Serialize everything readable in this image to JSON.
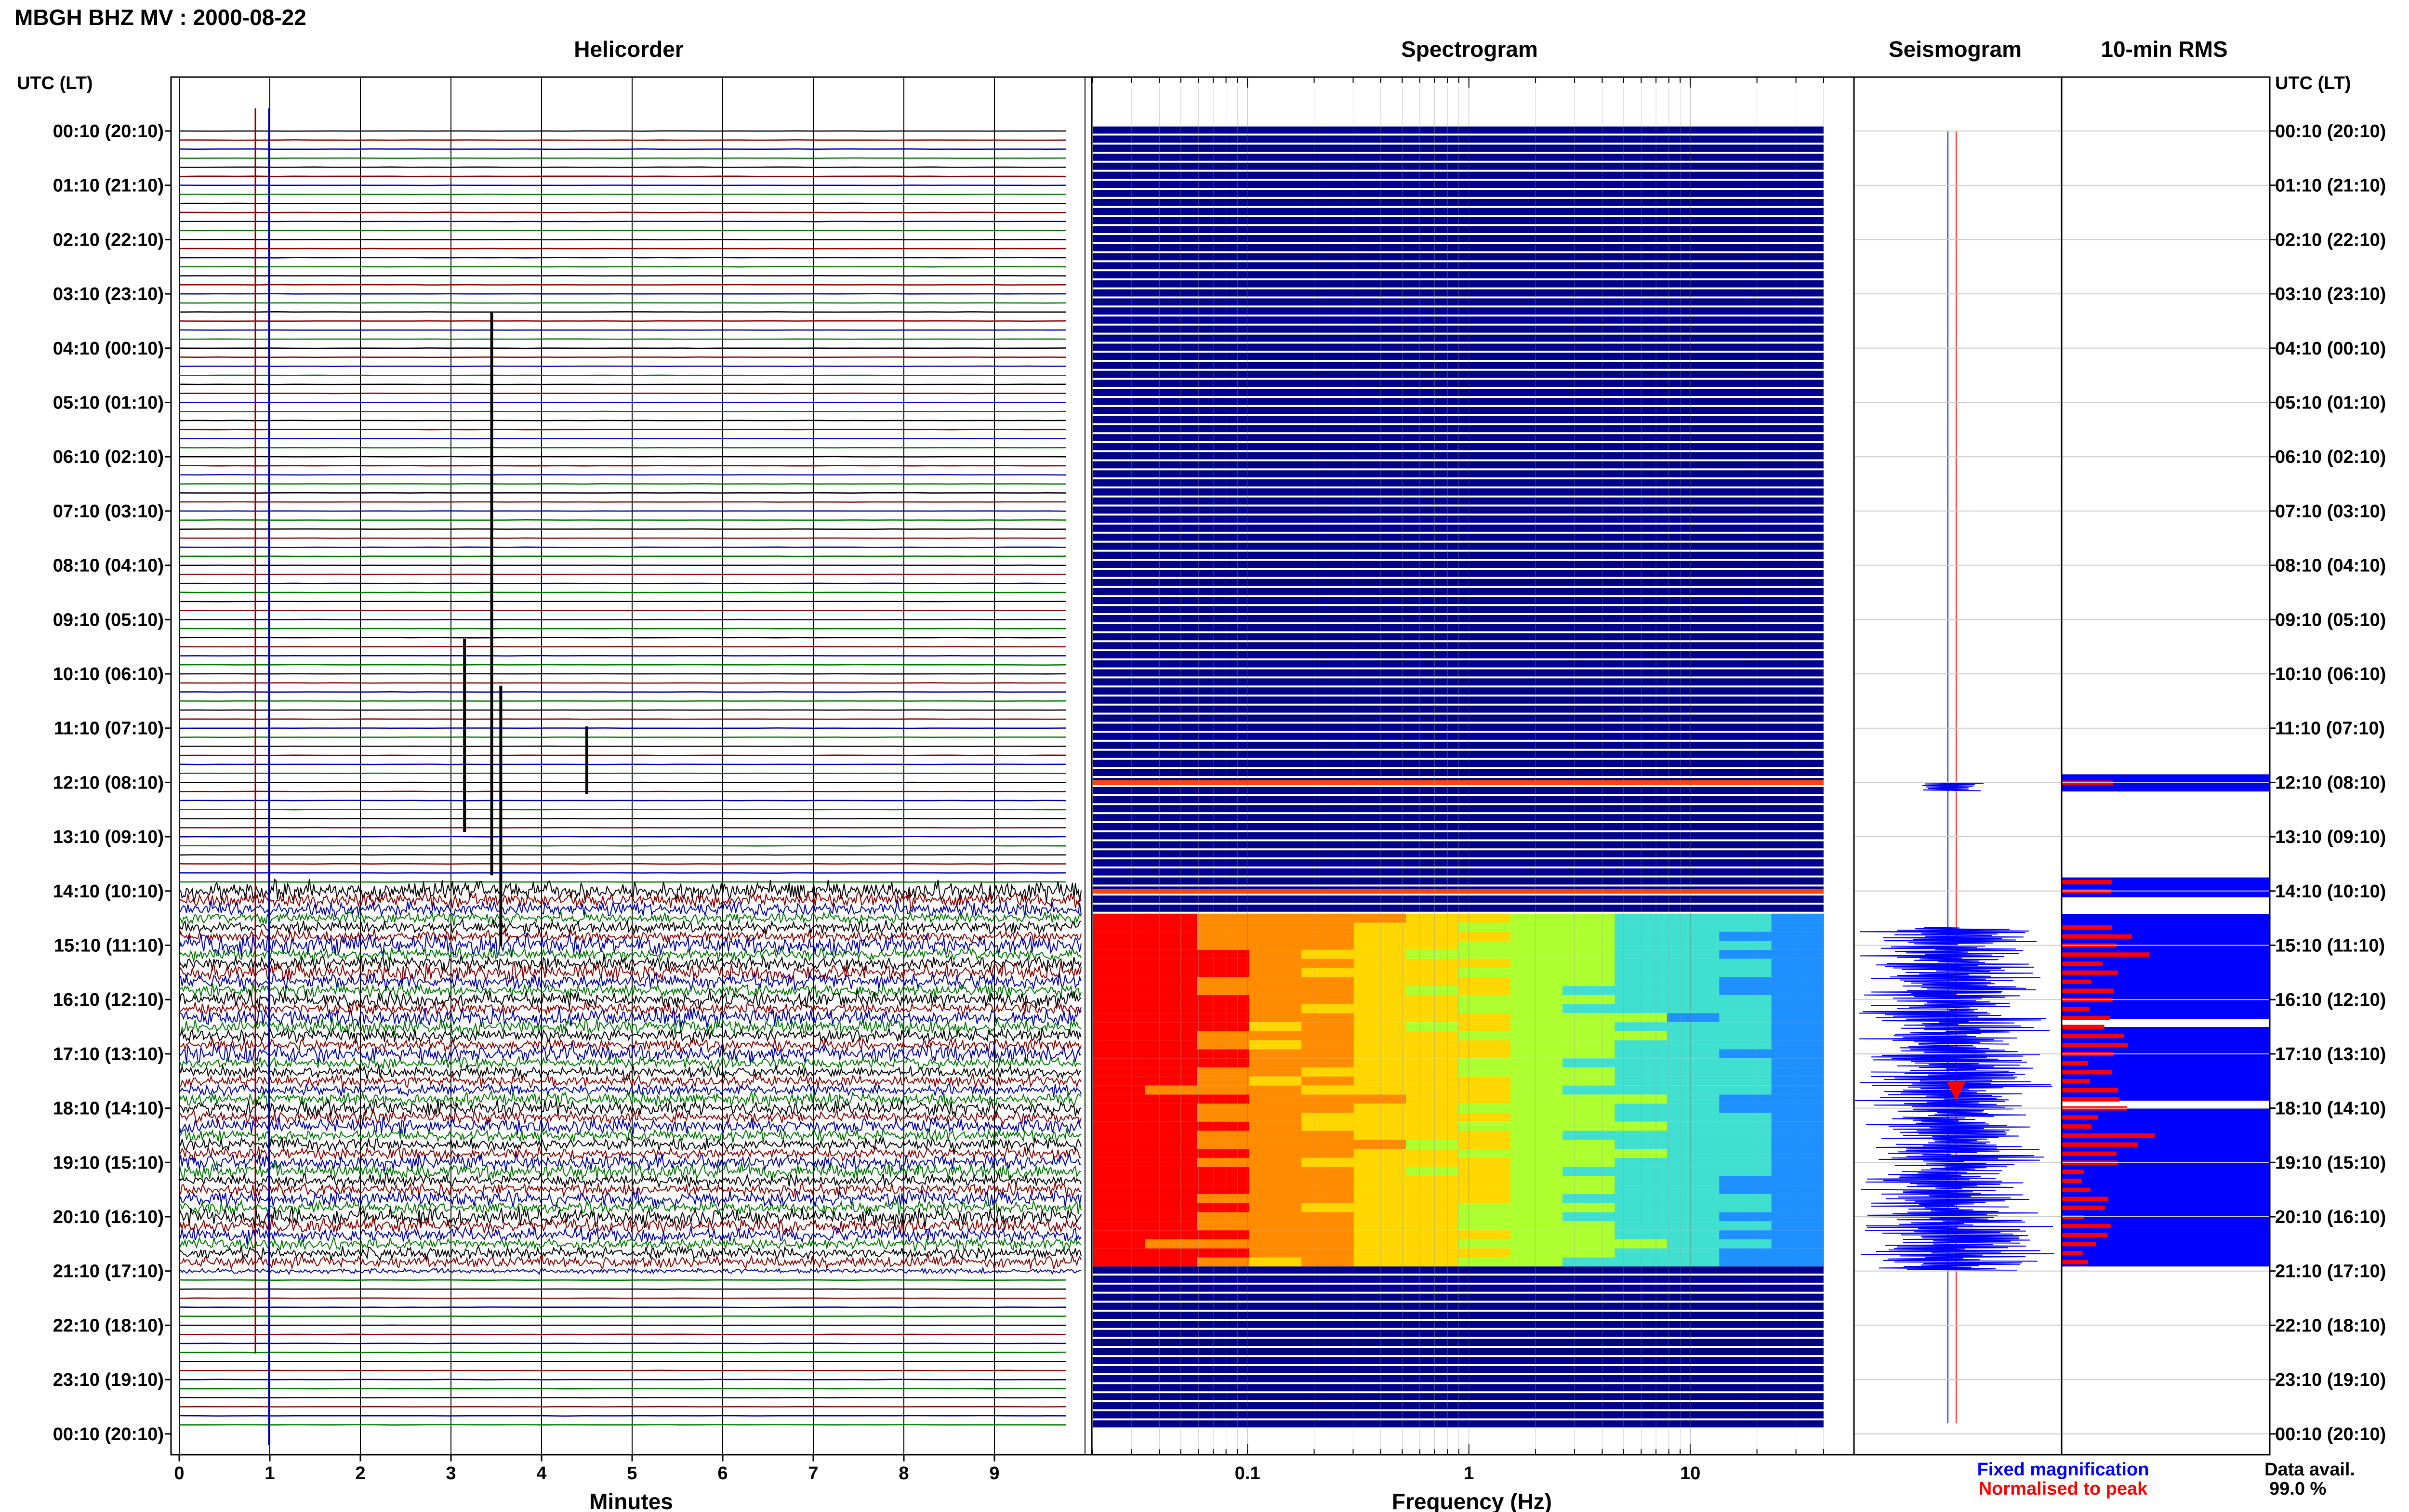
{
  "header": {
    "station_title": "MBGH BHZ MV : 2000-08-22"
  },
  "panels": {
    "helicorder": "Helicorder",
    "spectrogram": "Spectrogram",
    "seismogram": "Seismogram",
    "rms": "10-min RMS"
  },
  "axes": {
    "left_header": "UTC (LT)",
    "right_header": "UTC (LT)",
    "helicorder_xlabel": "Minutes",
    "spectrogram_xlabel": "Frequency (Hz)"
  },
  "legend": {
    "fixed": "Fixed magnification",
    "normalised": "Normalised to peak",
    "fixed_color": "#0000ff",
    "normalised_color": "#ff0000"
  },
  "availability": {
    "label": "Data avail.",
    "value": "99.0 %"
  },
  "colors": {
    "trace_cycle": [
      "#000000",
      "#8b0000",
      "#0000aa",
      "#007700"
    ],
    "spectrogram_background": "#00008b",
    "rms_fill": "#0000ff",
    "rms_peak": "#ff0000"
  },
  "chart_data": [
    {
      "type": "line",
      "title": "Helicorder",
      "xlabel": "Minutes",
      "xlim": [
        0,
        10
      ],
      "x_ticks": [
        "0",
        "1",
        "2",
        "3",
        "4",
        "5",
        "6",
        "7",
        "8",
        "9"
      ],
      "time_labels": [
        "00:10 (20:10)",
        "01:10 (21:10)",
        "02:10 (22:10)",
        "03:10 (23:10)",
        "04:10 (00:10)",
        "05:10 (01:10)",
        "06:10 (02:10)",
        "07:10 (03:10)",
        "08:10 (04:10)",
        "09:10 (05:10)",
        "10:10 (06:10)",
        "11:10 (07:10)",
        "12:10 (08:10)",
        "13:10 (09:10)",
        "14:10 (10:10)",
        "15:10 (11:10)",
        "16:10 (12:10)",
        "17:10 (13:10)",
        "18:10 (14:10)",
        "19:10 (15:10)",
        "20:10 (16:10)",
        "21:10 (17:10)",
        "22:10 (18:10)",
        "23:10 (19:10)",
        "00:10 (20:10)"
      ],
      "rows_per_hour": 6,
      "active_period_utc": [
        "14:10",
        "21:00"
      ]
    },
    {
      "type": "heatmap",
      "title": "Spectrogram",
      "xlabel": "Frequency (Hz)",
      "x_scale": "log",
      "xlim": [
        0.02,
        40
      ],
      "x_ticks": [
        "0.1",
        "1",
        "10"
      ],
      "active_rows_utc": [
        "12:10",
        "14:10",
        "15:10",
        "16:10",
        "17:10",
        "18:10",
        "19:10",
        "20:10"
      ]
    },
    {
      "type": "line",
      "title": "Seismogram",
      "series": [
        {
          "name": "Fixed magnification",
          "color": "#0000ff"
        },
        {
          "name": "Normalised to peak",
          "color": "#ff0000"
        }
      ]
    },
    {
      "type": "bar",
      "title": "10-min RMS",
      "orientation": "horizontal",
      "series": [
        {
          "name": "Fixed magnification",
          "color": "#0000ff"
        },
        {
          "name": "Normalised to peak",
          "color": "#ff0000"
        }
      ],
      "active_period_utc": [
        "12:10",
        "21:00"
      ]
    }
  ]
}
